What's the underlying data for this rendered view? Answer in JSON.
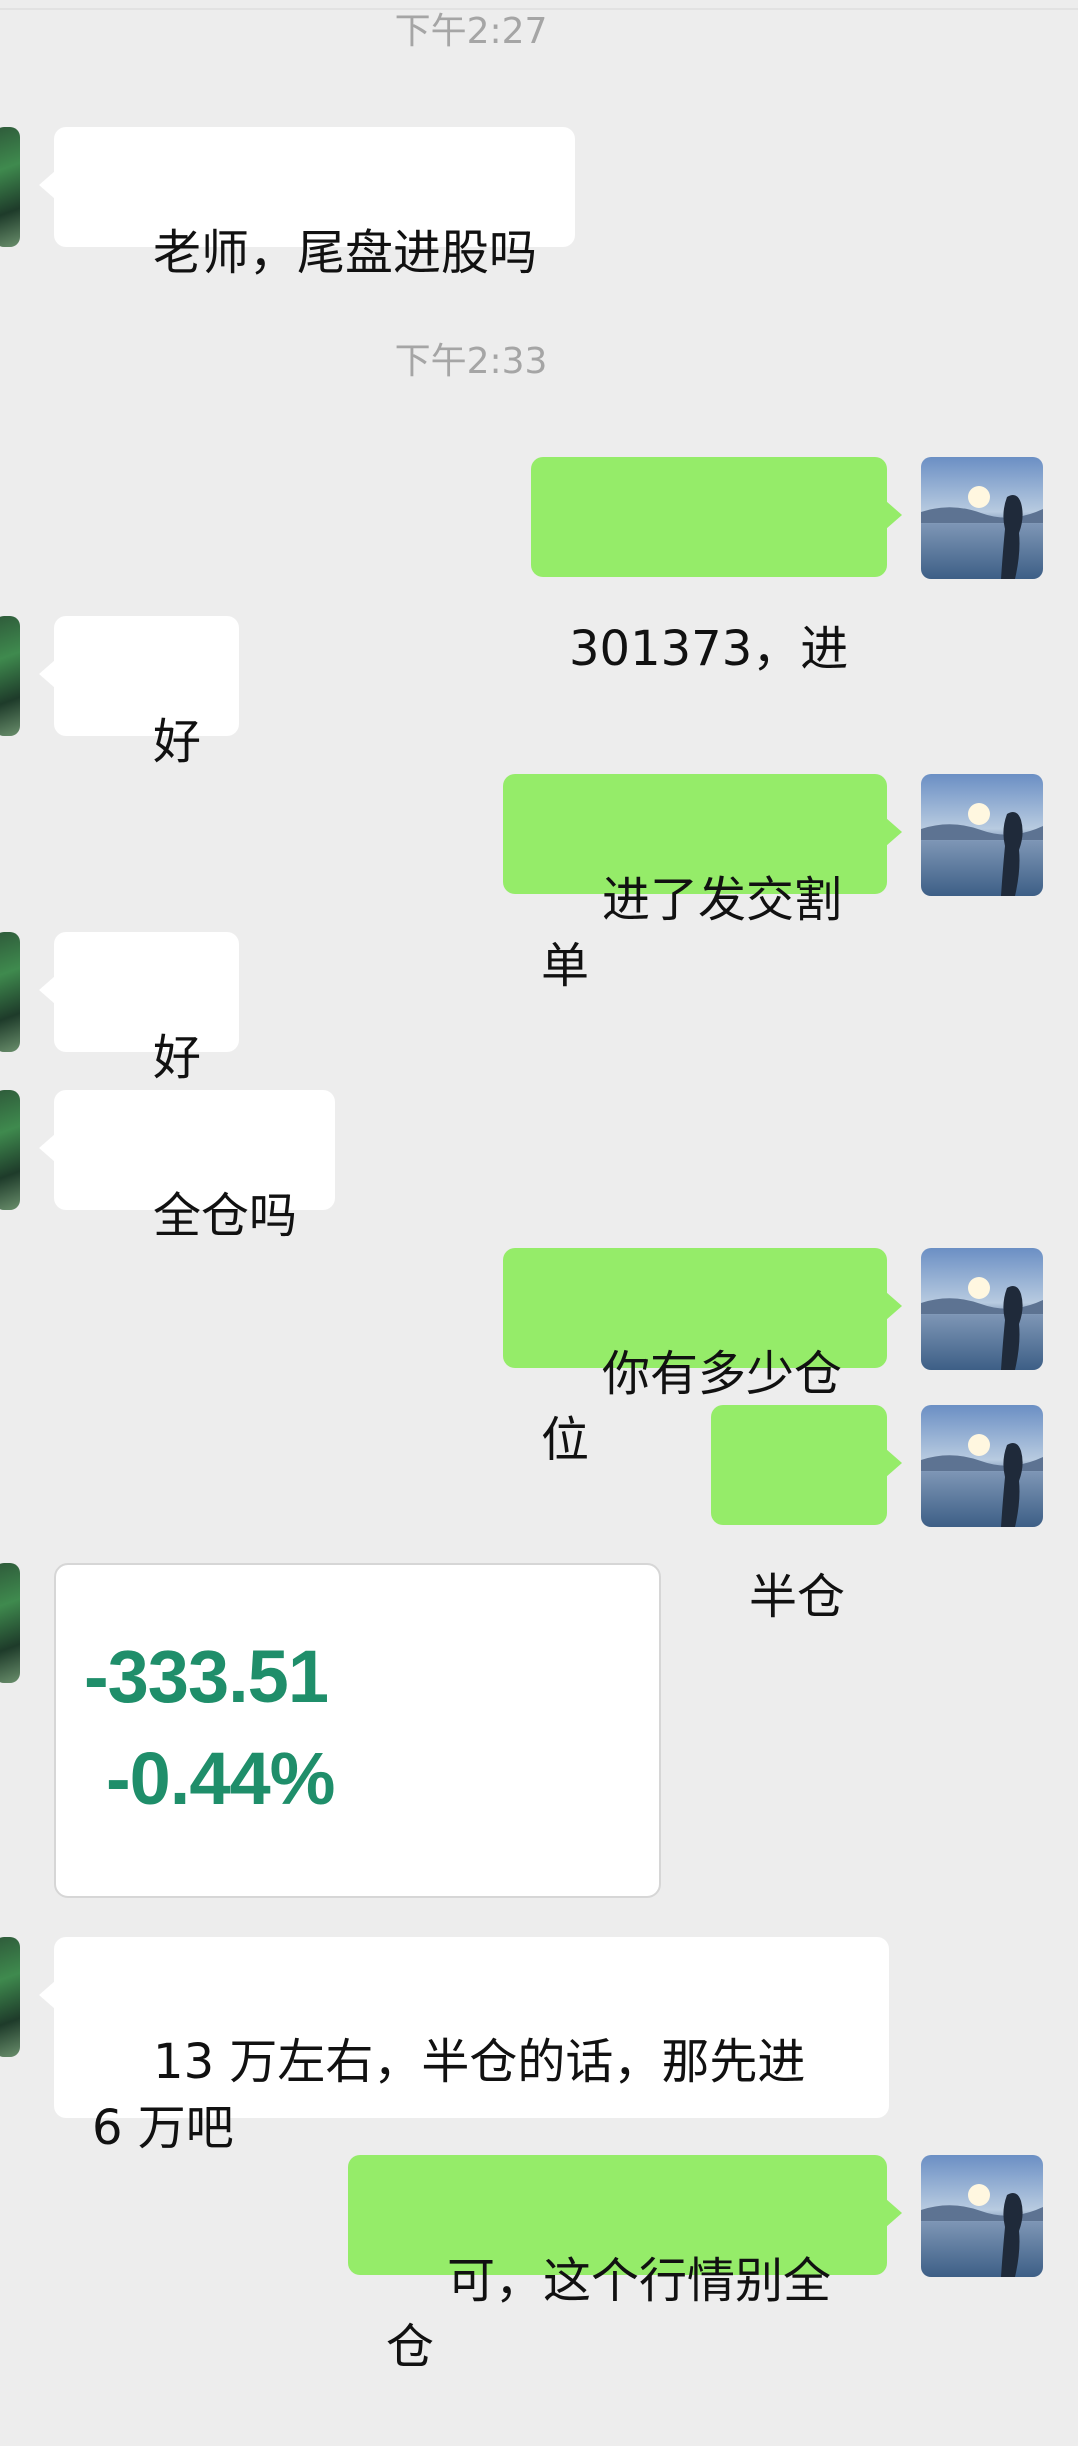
{
  "chat": {
    "timestamps": [
      "下午2:27",
      "下午2:33"
    ],
    "messages": [
      {
        "side": "left",
        "text": "老师，尾盘进股吗"
      },
      {
        "side": "right",
        "text": "301373，进"
      },
      {
        "side": "left",
        "text": "好"
      },
      {
        "side": "right",
        "text": "进了发交割单"
      },
      {
        "side": "left",
        "text": "好"
      },
      {
        "side": "left",
        "text": "全仓吗"
      },
      {
        "side": "right",
        "text": "你有多少仓位"
      },
      {
        "side": "right",
        "text": "半仓"
      },
      {
        "side": "left",
        "type": "image-card",
        "line1": "-333.51",
        "line2": "-0.44%"
      },
      {
        "side": "left",
        "text": "13 万左右，半仓的话，那先进 6 万吧"
      },
      {
        "side": "right",
        "text": "可，这个行情别全仓"
      }
    ]
  },
  "icons": {
    "left_avatar": "contact-avatar-icon",
    "right_avatar": "self-avatar-icon"
  },
  "colors": {
    "background": "#ededed",
    "incoming_bubble": "#ffffff",
    "outgoing_bubble": "#95ec69",
    "timestamp": "#a5a5a5",
    "loss_green": "#1f8e6a"
  }
}
